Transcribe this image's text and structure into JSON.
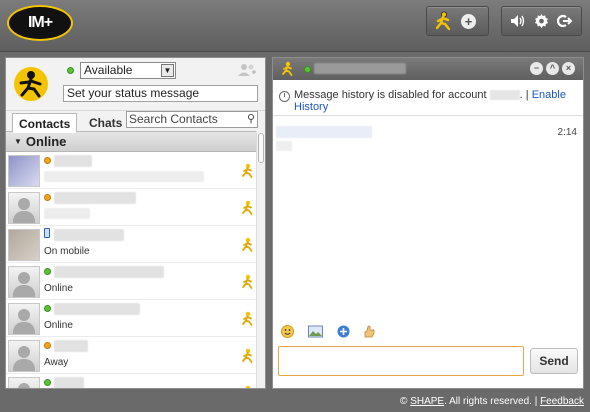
{
  "app": {
    "logo_text": "IM+"
  },
  "toolbar": {
    "add_contact_icon": "runner-plus-icon",
    "sound_icon": "speaker-icon",
    "settings_icon": "gear-icon",
    "logout_icon": "logout-icon"
  },
  "profile": {
    "status_value": "Available",
    "status_message_placeholder": "Set your status message"
  },
  "tabs": {
    "contacts_label": "Contacts",
    "chats_label": "Chats",
    "search_placeholder": "Search Contacts"
  },
  "group": {
    "name": "Online"
  },
  "contacts": [
    {
      "status": "away",
      "sub": ""
    },
    {
      "status": "away",
      "sub": ""
    },
    {
      "status": "mobile",
      "sub": "On mobile"
    },
    {
      "status": "online",
      "sub": "Online"
    },
    {
      "status": "online",
      "sub": "Online"
    },
    {
      "status": "away",
      "sub": "Away"
    },
    {
      "status": "online",
      "sub": ""
    }
  ],
  "chat": {
    "history_text_before": "Message history is disabled for account ",
    "history_text_after": ". | ",
    "history_link": "Enable History",
    "message_time": "2:14",
    "send_label": "Send"
  },
  "footer": {
    "copyright_prefix": "© ",
    "brand_link": "SHAPE",
    "copyright_suffix": ". All rights reserved. | ",
    "feedback_link": "Feedback"
  },
  "colors": {
    "accent": "#f4c400",
    "online": "#5bc335",
    "away": "#f3a31b",
    "link": "#1a55c7",
    "input_focus": "#e6a74a"
  }
}
